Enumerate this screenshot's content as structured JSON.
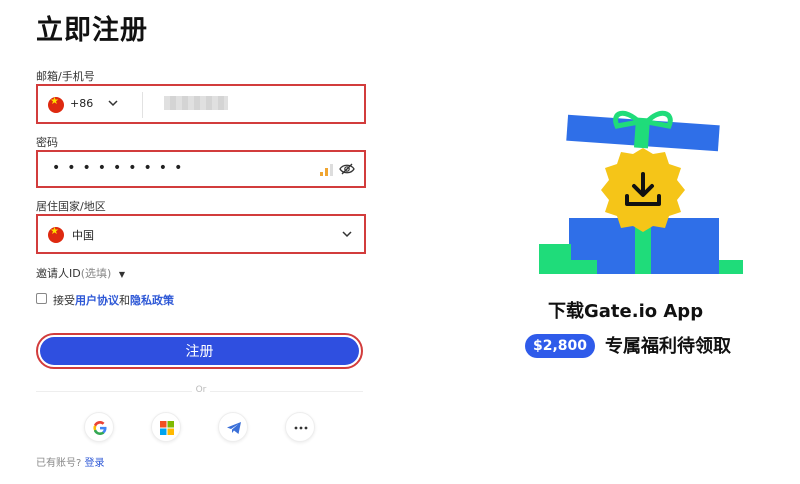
{
  "page": {
    "title": "立即注册"
  },
  "form": {
    "contact_label": "邮箱/手机号",
    "country_code": "+86",
    "password_label": "密码",
    "password_mask": "•••••••••",
    "country_label": "居住国家/地区",
    "country_value": "中国",
    "invite_label": "邀请人ID",
    "invite_optional": "(选填)",
    "agree_prefix": "接受",
    "agree_terms": "用户协议",
    "agree_and": "和",
    "agree_privacy": "隐私政策",
    "submit_label": "注册",
    "or_text": "Or"
  },
  "social": {
    "items": [
      {
        "name": "google",
        "icon": "google-icon"
      },
      {
        "name": "microsoft",
        "icon": "microsoft-icon"
      },
      {
        "name": "telegram",
        "icon": "telegram-icon"
      },
      {
        "name": "more",
        "icon": "more-dots-icon"
      }
    ]
  },
  "login": {
    "prompt": "已有账号?",
    "link": "登录"
  },
  "promo": {
    "title": "下载Gate.io App",
    "amount": "$2,800",
    "subtitle": "专属福利待领取"
  },
  "colors": {
    "accent": "#2f4fe0",
    "highlight_border": "#d23c3c",
    "promo_blue": "#2f6fe8",
    "promo_green": "#1fdc7a",
    "promo_yellow": "#f5c518"
  }
}
